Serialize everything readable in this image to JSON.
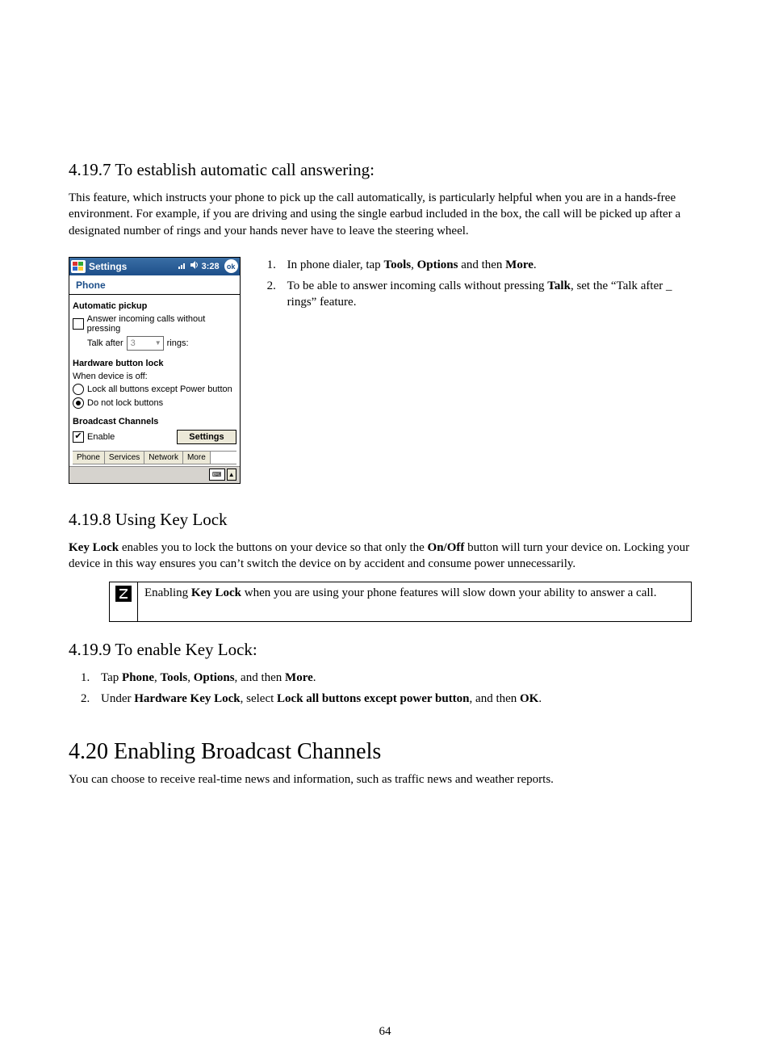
{
  "section_4197": {
    "heading": "4.19.7  To establish automatic call answering:",
    "para": "This feature, which instructs your phone to pick up the call automatically, is particularly helpful when you are in a hands-free environment. For example, if you are driving and using the single earbud included in the box, the call will be picked up after a designated number of rings and your hands never have to leave the steering wheel.",
    "list": {
      "i1_pre": "In phone dialer, tap ",
      "i1_b1": "Tools",
      "i1_m1": ", ",
      "i1_b2": "Options",
      "i1_m2": " and then ",
      "i1_b3": "More",
      "i1_post": ".",
      "i2_pre": "To be able to answer incoming calls without pressing ",
      "i2_b1": "Talk",
      "i2_post": ", set the “Talk after _ rings” feature."
    }
  },
  "screenshot": {
    "title": "Settings",
    "time": "3:28",
    "ok": "ok",
    "subhead": "Phone",
    "auto_pickup": "Automatic pickup",
    "answer_label": "Answer incoming calls without pressing",
    "talk_after": "Talk after",
    "select_val": "3",
    "rings": "rings:",
    "hw_lock": "Hardware button lock",
    "when_off": "When device is off:",
    "lock_all": "Lock all buttons except Power button",
    "no_lock": "Do not lock buttons",
    "bc": "Broadcast Channels",
    "enable": "Enable",
    "settings_btn": "Settings",
    "tabs": {
      "phone": "Phone",
      "services": "Services",
      "network": "Network",
      "more": "More"
    }
  },
  "section_4198": {
    "heading": "4.19.8  Using Key Lock",
    "para_b1": "Key Lock",
    "para_m1": " enables you to lock the buttons on your device so that only the ",
    "para_b2": "On/Off",
    "para_m2": " button will turn your device on. Locking your device in this way ensures you can’t switch the device on by accident and consume power unnecessarily.",
    "note_pre": "Enabling ",
    "note_b1": "Key Lock",
    "note_post": " when you are using your phone features will slow down your ability to answer a call."
  },
  "section_4199": {
    "heading": "4.19.9 To enable Key Lock:",
    "i1_pre": "Tap ",
    "i1_b1": "Phone",
    "i1_m1": ", ",
    "i1_b2": "Tools",
    "i1_m2": ", ",
    "i1_b3": "Options",
    "i1_m3": ", and then ",
    "i1_b4": "More",
    "i1_post": ".",
    "i2_pre": "Under ",
    "i2_b1": "Hardware Key Lock",
    "i2_m1": ", select ",
    "i2_b2": "Lock all buttons except power button",
    "i2_m2": ", and then ",
    "i2_b3": "OK",
    "i2_post": "."
  },
  "section_420": {
    "heading": "4.20  Enabling Broadcast Channels",
    "para": "You can choose to receive real-time news and information, such as traffic news and weather reports."
  },
  "page_number": "64"
}
